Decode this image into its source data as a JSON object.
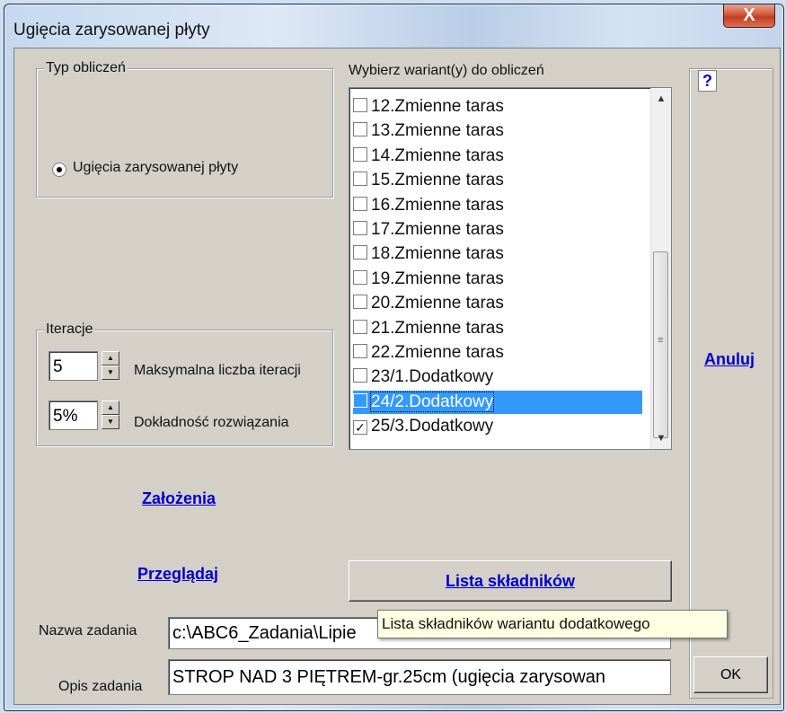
{
  "window": {
    "title": "Ugięcia zarysowanej płyty",
    "close_glyph": "X"
  },
  "calc_type": {
    "label": "Typ obliczeń",
    "option": "Ugięcia zarysowanej płyty"
  },
  "iteration": {
    "label": "Iteracje",
    "max_value": "5",
    "max_label": "Maksymalna liczba iteracji",
    "accuracy_value": "5%",
    "accuracy_label": "Dokładność rozwiązania"
  },
  "variants": {
    "label": "Wybierz wariant(y) do obliczeń",
    "items": [
      {
        "label": "12.Zmienne taras",
        "checked": false
      },
      {
        "label": "13.Zmienne taras",
        "checked": false
      },
      {
        "label": "14.Zmienne taras",
        "checked": false
      },
      {
        "label": "15.Zmienne taras",
        "checked": false
      },
      {
        "label": "16.Zmienne taras",
        "checked": false
      },
      {
        "label": "17.Zmienne taras",
        "checked": false
      },
      {
        "label": "18.Zmienne taras",
        "checked": false
      },
      {
        "label": "19.Zmienne taras",
        "checked": false
      },
      {
        "label": "20.Zmienne taras",
        "checked": false
      },
      {
        "label": "21.Zmienne taras",
        "checked": false
      },
      {
        "label": "22.Zmienne taras",
        "checked": false
      },
      {
        "label": "23/1.Dodatkowy",
        "checked": false
      },
      {
        "label": "24/2.Dodatkowy",
        "checked": false,
        "selected": true
      },
      {
        "label": "25/3.Dodatkowy",
        "checked": true
      }
    ]
  },
  "links": {
    "assumptions": "Założenia",
    "browse": "Przeglądaj",
    "cancel": "Anuluj"
  },
  "buttons": {
    "components": "Lista składników",
    "ok": "OK",
    "help": "?"
  },
  "task": {
    "name_label": "Nazwa zadania",
    "name_value": "c:\\ABC6_Zadania\\Lipie",
    "desc_label": "Opis zadania",
    "desc_value": "STROP NAD 3 PIĘTREM-gr.25cm (ugięcia zarysowan"
  },
  "tooltip": "Lista składników wariantu dodatkowego",
  "colors": {
    "selection": "#3399ff",
    "link": "#0000cc",
    "dialog_bg": "#d4d0c8"
  }
}
